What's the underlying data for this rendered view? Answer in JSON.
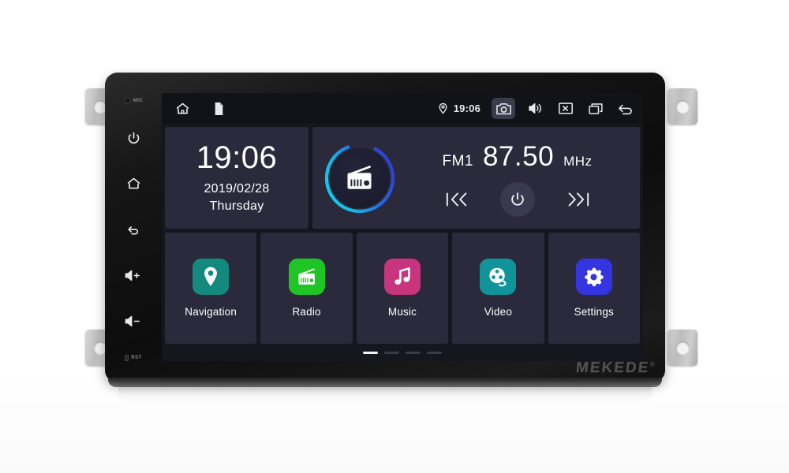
{
  "device": {
    "brand": "MEKEDE",
    "brand_mark": "®",
    "hw_keys": [
      {
        "name": "mic",
        "label": "MIC"
      },
      {
        "name": "power",
        "label": ""
      },
      {
        "name": "home",
        "label": ""
      },
      {
        "name": "back",
        "label": ""
      },
      {
        "name": "volume-up",
        "label": ""
      },
      {
        "name": "volume-down",
        "label": ""
      },
      {
        "name": "reset",
        "label": "RST"
      }
    ]
  },
  "statusbar": {
    "home_icon": "home-icon",
    "sdcard_icon": "sdcard-icon",
    "location_icon": "location-pin-icon",
    "time": "19:06",
    "camera_icon": "camera-icon",
    "volume_icon": "speaker-icon",
    "close_icon": "close-box-icon",
    "recents_icon": "recents-icon",
    "back_icon": "back-arrow-icon"
  },
  "clock_widget": {
    "time": "19:06",
    "date": "2019/02/28",
    "weekday": "Thursday"
  },
  "radio_widget": {
    "icon": "radio-icon",
    "band": "FM1",
    "frequency": "87.50",
    "unit": "MHz",
    "prev_label": "|«",
    "next_label": "»|",
    "power_icon": "power-icon",
    "ring_start_color": "#00d9e8",
    "ring_end_color": "#2b3fd8"
  },
  "apps": [
    {
      "label": "Navigation",
      "icon": "map-pin-icon",
      "color": "#14897e"
    },
    {
      "label": "Radio",
      "icon": "radio-icon",
      "color": "#1fc425"
    },
    {
      "label": "Music",
      "icon": "music-note-icon",
      "color": "#c8347d"
    },
    {
      "label": "Video",
      "icon": "film-reel-icon",
      "color": "#11939b"
    },
    {
      "label": "Settings",
      "icon": "gear-icon",
      "color": "#3434e0"
    }
  ],
  "pager": {
    "pages": 4,
    "active_index": 0
  },
  "theme": {
    "screen_bg": "#16161f",
    "tile_bg": "#2a2a3c",
    "statusbar_bg": "#121219",
    "text": "#ffffff"
  }
}
